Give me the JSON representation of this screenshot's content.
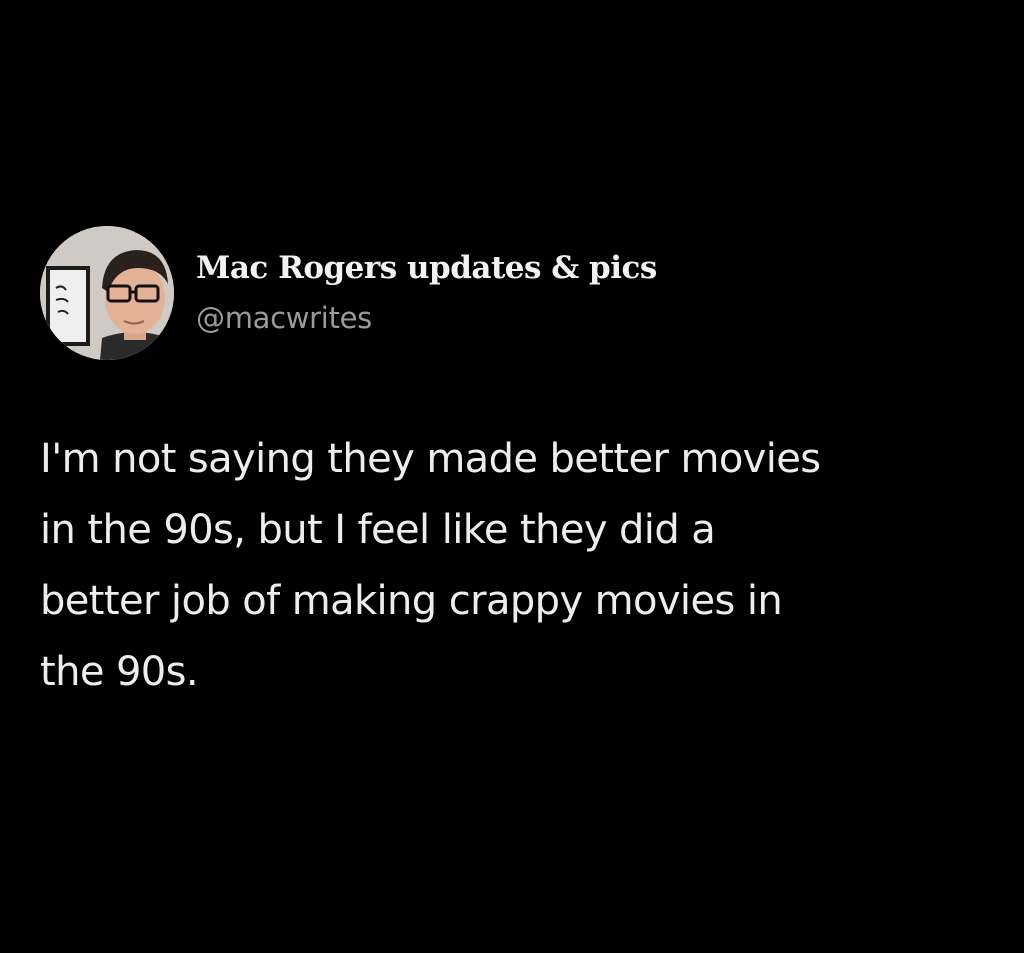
{
  "author": {
    "display_name": "Mac Rogers updates & pics",
    "handle": "@macwrites",
    "avatar_icon": "profile-photo"
  },
  "tweet": {
    "lines": [
      "I'm not saying they made better movies",
      "in the 90s, but I feel like they did a",
      "better job of making crappy movies in",
      "the 90s."
    ]
  },
  "colors": {
    "background": "#000000",
    "name": "#f2f2f2",
    "handle": "#9a9a9a",
    "body_text": "#ededed"
  }
}
